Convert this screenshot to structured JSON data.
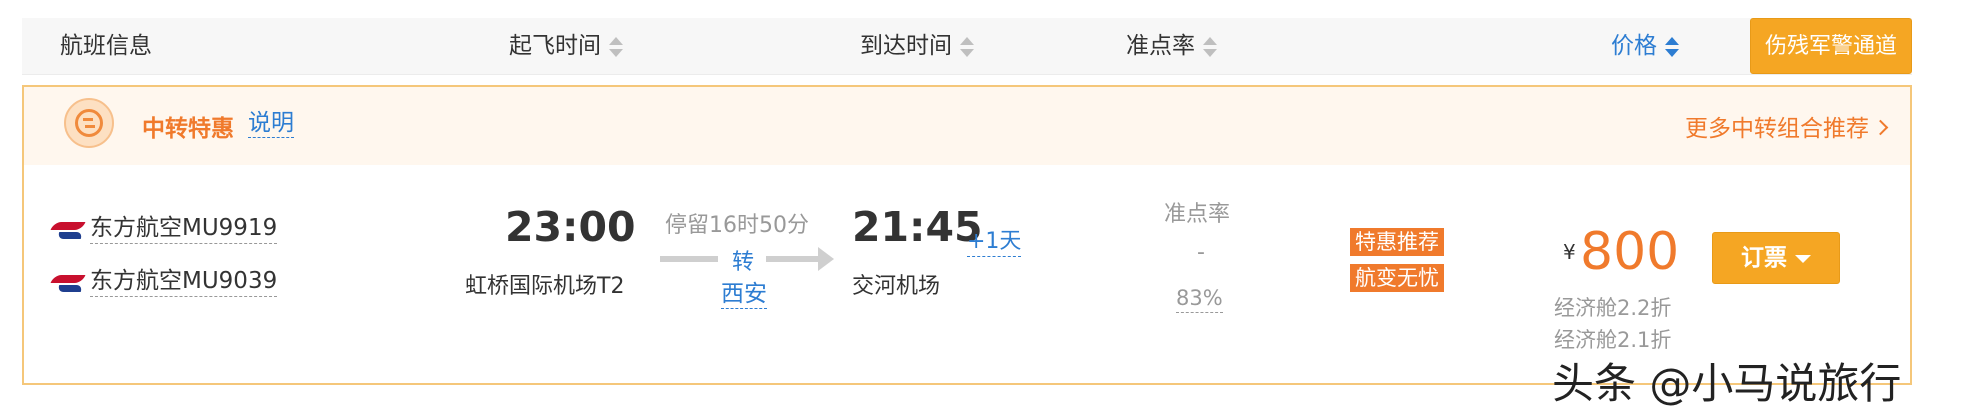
{
  "header": {
    "col_flight": "航班信息",
    "col_departure": "起飞时间",
    "col_arrival": "到达时间",
    "col_ontime": "准点率",
    "col_price": "价格",
    "military_button": "伤残军警通道"
  },
  "banner": {
    "title": "中转特惠",
    "explain_link": "说明",
    "more_link": "更多中转组合推荐"
  },
  "flight": {
    "segments": [
      {
        "airline": "东方航空MU9919",
        "logo_icon": "china-eastern-logo"
      },
      {
        "airline": "东方航空MU9039",
        "logo_icon": "china-eastern-logo"
      }
    ],
    "departure_time": "23:00",
    "departure_airport": "虹桥国际机场T2",
    "stopover": "停留16时50分",
    "transfer_label": "转",
    "transfer_city": "西安",
    "arrival_time": "21:45",
    "arrival_next_day": "+1天",
    "arrival_airport": "交河机场",
    "ontime_label": "准点率",
    "ontime_first": "-",
    "ontime_second": "83%",
    "tags": [
      "特惠推荐",
      "航变无忧"
    ],
    "currency": "¥",
    "price": "800",
    "discounts": [
      "经济舱2.2折",
      "经济舱2.1折"
    ],
    "book_button": "订票"
  },
  "watermark": "头条 @小马说旅行",
  "colors": {
    "accent_orange": "#f07a2c",
    "button_orange": "#f5a623",
    "link_blue": "#2d7dd2"
  }
}
